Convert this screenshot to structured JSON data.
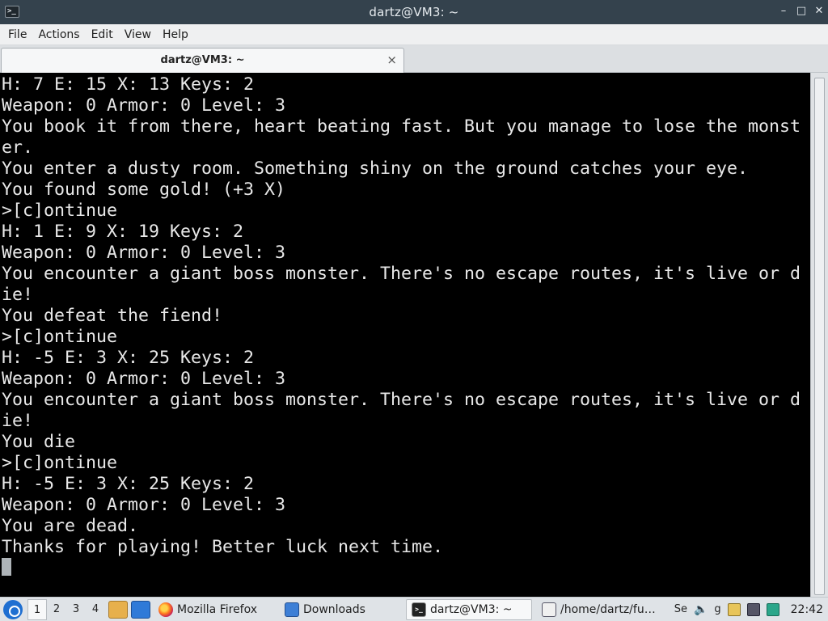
{
  "window": {
    "title": "dartz@VM3: ~",
    "controls": {
      "minimize": "–",
      "maximize": "□",
      "close": "✕"
    }
  },
  "menu": [
    "File",
    "Actions",
    "Edit",
    "View",
    "Help"
  ],
  "tab": {
    "label": "dartz@VM3: ~",
    "close": "⨯"
  },
  "terminal": {
    "lines": [
      "H: 7 E: 15 X: 13 Keys: 2",
      "Weapon: 0 Armor: 0 Level: 3",
      "You book it from there, heart beating fast. But you manage to lose the monst",
      "er.",
      "You enter a dusty room. Something shiny on the ground catches your eye.",
      "You found some gold! (+3 X)",
      ">[c]ontinue",
      "H: 1 E: 9 X: 19 Keys: 2",
      "Weapon: 0 Armor: 0 Level: 3",
      "You encounter a giant boss monster. There's no escape routes, it's live or d",
      "ie!",
      "You defeat the fiend!",
      ">[c]ontinue",
      "H: -5 E: 3 X: 25 Keys: 2",
      "Weapon: 0 Armor: 0 Level: 3",
      "You encounter a giant boss monster. There's no escape routes, it's live or d",
      "ie!",
      "You die",
      ">[c]ontinue",
      "H: -5 E: 3 X: 25 Keys: 2",
      "Weapon: 0 Armor: 0 Level: 3",
      "You are dead.",
      "Thanks for playing! Better luck next time."
    ]
  },
  "taskbar": {
    "workspaces": [
      "1",
      "2",
      "3",
      "4"
    ],
    "active_workspace": "1",
    "tasks": [
      {
        "label": "Mozilla Firefox",
        "icon": "firefox-icon"
      },
      {
        "label": "Downloads",
        "icon": "folder-icon"
      },
      {
        "label": "dartz@VM3: ~",
        "icon": "terminal-icon"
      },
      {
        "label": "/home/dartz/fu…",
        "icon": "text-editor-icon"
      }
    ],
    "tray": {
      "truncated1": "Se",
      "truncated2": "g"
    },
    "clock": "22:42"
  }
}
